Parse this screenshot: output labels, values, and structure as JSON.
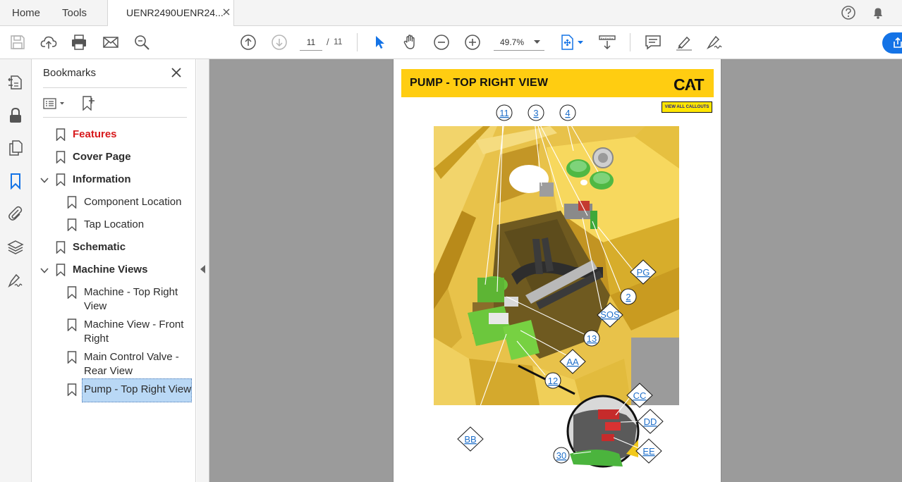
{
  "menubar": {
    "home_label": "Home",
    "tools_label": "Tools",
    "document_tab_title": "UENR2490UENR24..."
  },
  "toolbar": {
    "current_page": "11",
    "page_separator": "/",
    "total_pages": "11",
    "zoom_value": "49.7%"
  },
  "bookmarks": {
    "panel_title": "Bookmarks",
    "items": [
      {
        "label": "Features"
      },
      {
        "label": "Cover Page"
      },
      {
        "label": "Information"
      },
      {
        "label": "Component Location"
      },
      {
        "label": "Tap Location"
      },
      {
        "label": "Schematic"
      },
      {
        "label": "Machine Views"
      },
      {
        "label": "Machine - Top Right View"
      },
      {
        "label": "Machine View - Front Right"
      },
      {
        "label": "Main Control Valve - Rear View"
      },
      {
        "label": "Pump - Top Right View"
      }
    ]
  },
  "document": {
    "page_title": "PUMP - TOP RIGHT VIEW",
    "logo_text": "CAT",
    "view_all_label": "VIEW ALL CALLOUTS",
    "callouts": {
      "c11": "11",
      "c3": "3",
      "c4": "4",
      "pg": "PG",
      "c2": "2",
      "sos": "SOS",
      "c13": "13",
      "aa": "AA",
      "c12": "12",
      "bb": "BB",
      "cc": "CC",
      "dd": "DD",
      "ee": "EE",
      "c30": "30"
    }
  },
  "colors": {
    "cat_yellow": "#FFCD11",
    "accent_blue": "#1473E6",
    "features_red": "#D7191C",
    "selection_blue": "#B9D8F5",
    "pump_green": "#7ED321"
  },
  "icons": {
    "menubar": [
      "close-icon",
      "help-icon",
      "bell-icon"
    ],
    "toolbar": [
      "save-icon",
      "upload-icon",
      "print-icon",
      "email-icon",
      "zoom-search-icon",
      "page-up-icon",
      "page-down-icon",
      "select-arrow-icon",
      "hand-icon",
      "zoom-out-icon",
      "zoom-in-icon",
      "fit-page-icon",
      "scroll-mode-icon",
      "comment-icon",
      "highlight-pen-icon",
      "sign-icon",
      "share-icon"
    ],
    "left_rail": [
      "document-icon",
      "lock-icon",
      "pages-icon",
      "bookmark-icon",
      "attachment-icon",
      "layers-icon",
      "signature-icon"
    ]
  }
}
